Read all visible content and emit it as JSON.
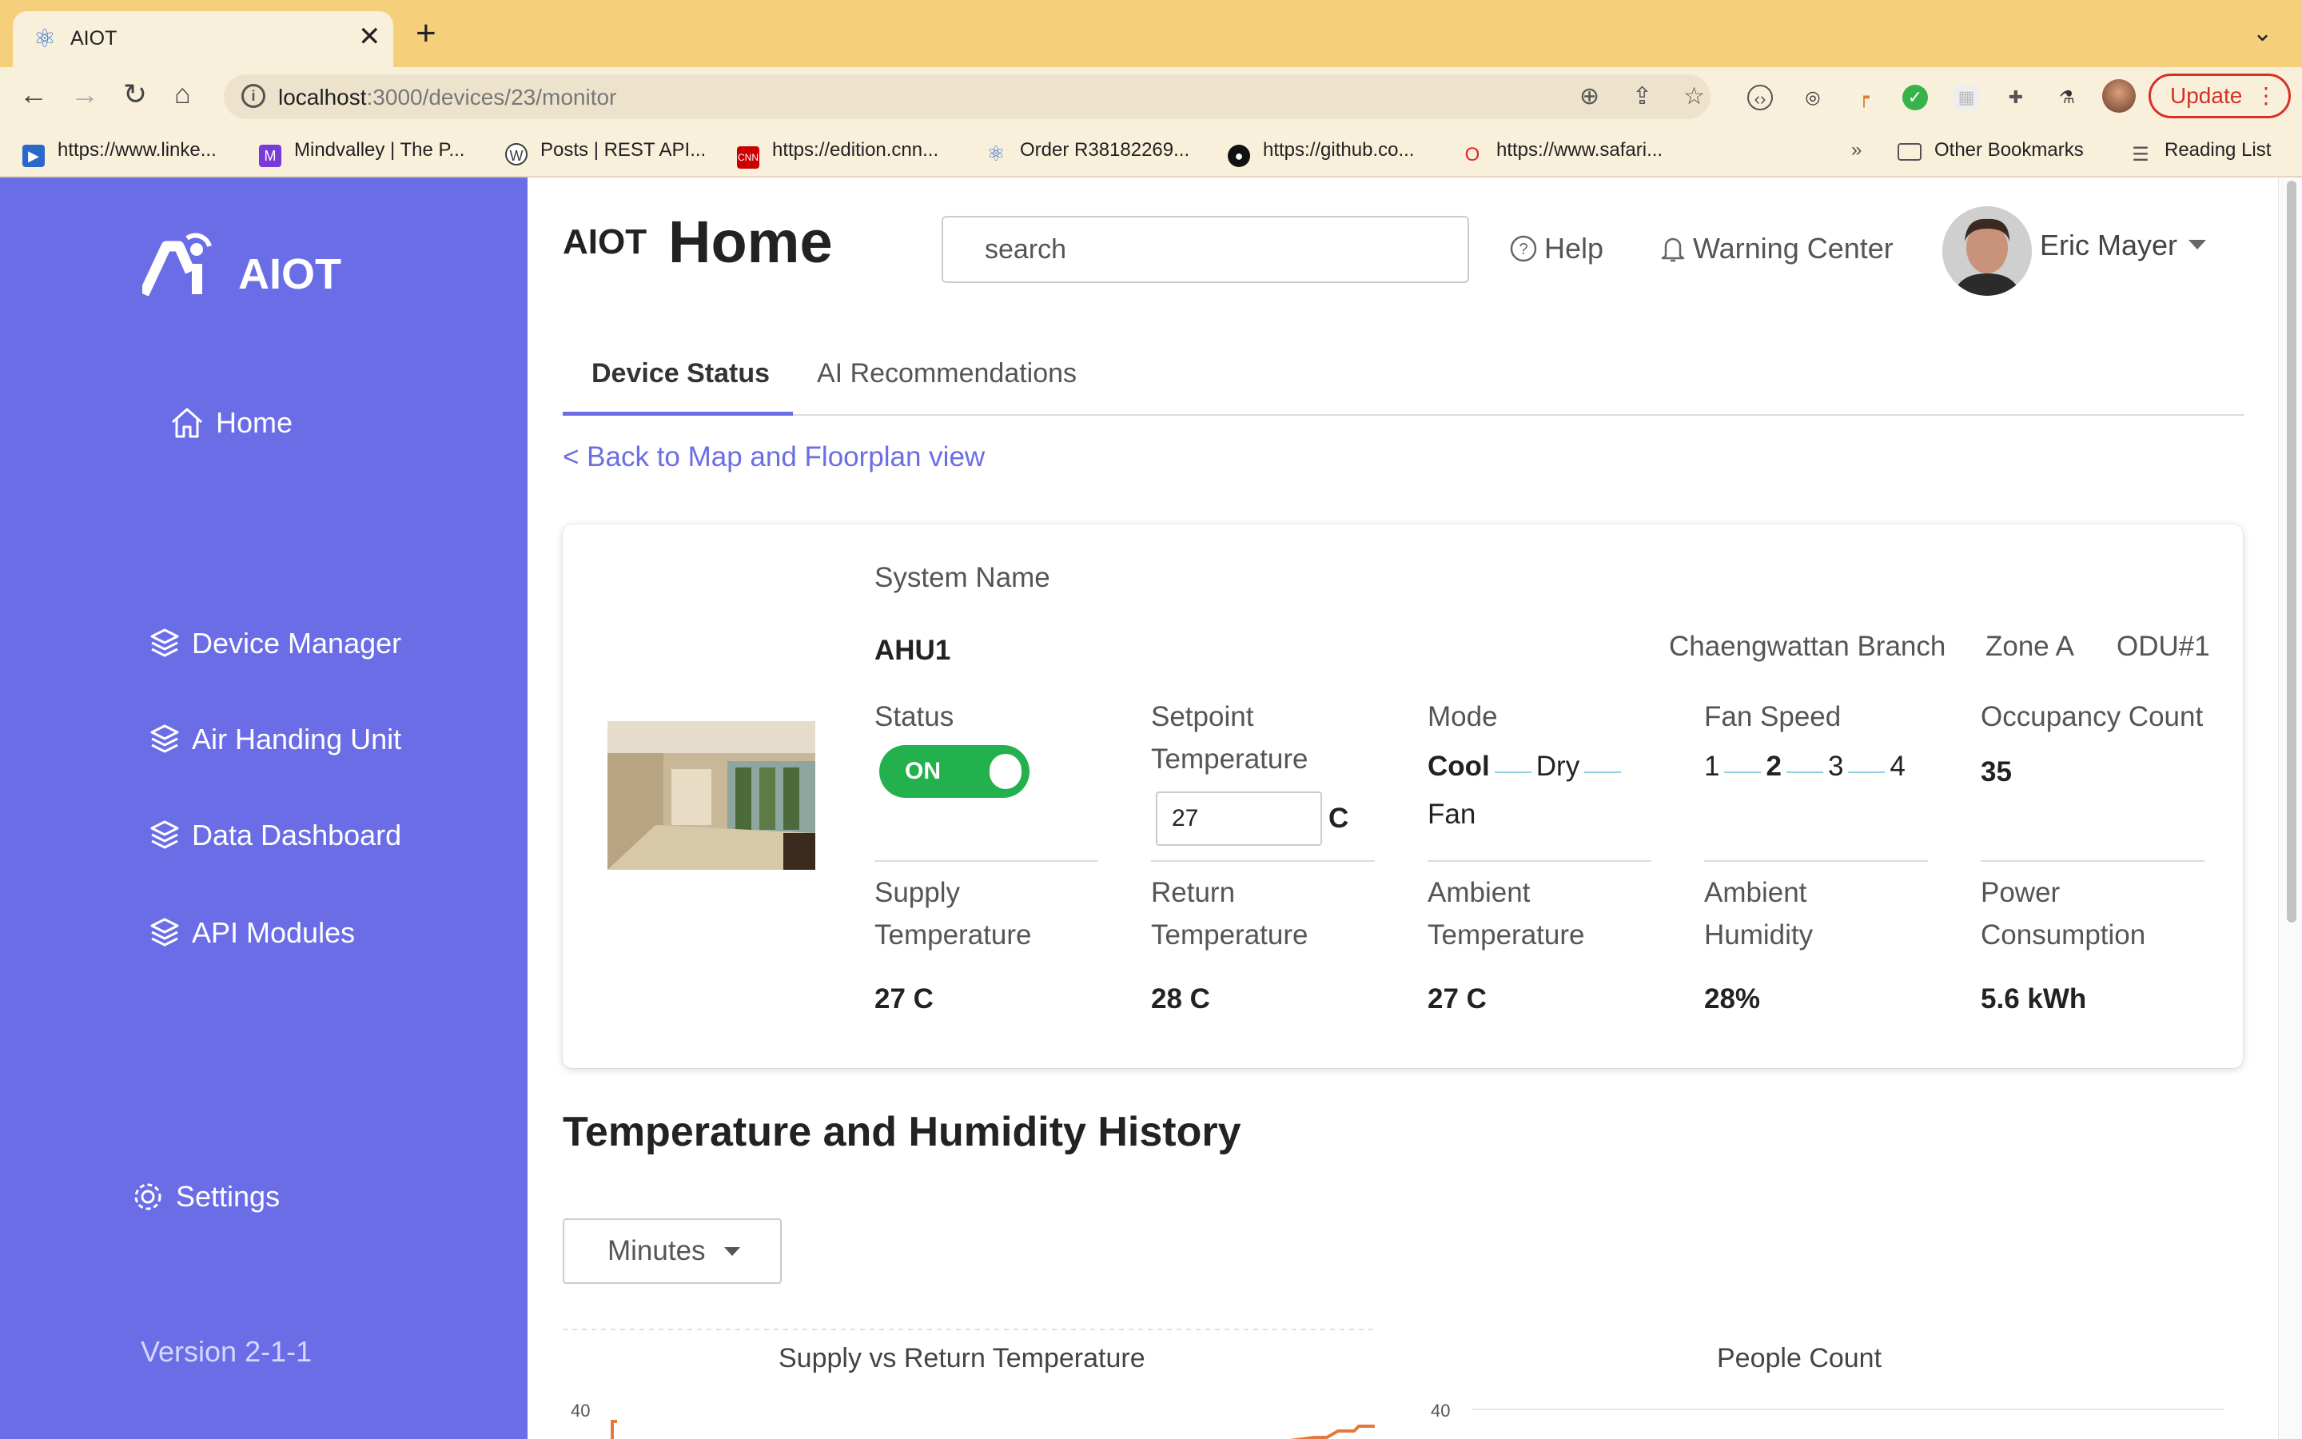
{
  "browser": {
    "tab_title": "AIOT",
    "url_host": "localhost",
    "url_path": ":3000/devices/23/monitor",
    "update_label": "Update",
    "bookmarks": [
      {
        "label": "https://www.linke...",
        "icon": "video-icon",
        "color": "#2a68c9"
      },
      {
        "label": "Mindvalley | The P...",
        "icon": "mindvalley-icon",
        "color": "#7a3ad9"
      },
      {
        "label": "Posts | REST API...",
        "icon": "wordpress-icon",
        "color": "#3d3d3d"
      },
      {
        "label": "https://edition.cnn...",
        "icon": "cnn-icon",
        "color": "#cc0000"
      },
      {
        "label": "Order R38182269...",
        "icon": "react-icon",
        "color": "#3a7bd5"
      },
      {
        "label": "https://github.co...",
        "icon": "github-icon",
        "color": "#111111"
      },
      {
        "label": "https://www.safari...",
        "icon": "safari-icon",
        "color": "#e02424"
      }
    ],
    "other_bookmarks": "Other Bookmarks",
    "reading_list": "Reading List",
    "overflow": "»"
  },
  "sidebar": {
    "logo": "AIOT",
    "items": [
      {
        "label": "Home",
        "icon": "home-icon"
      },
      {
        "label": "Device Manager",
        "icon": "layers-icon"
      },
      {
        "label": "Air Handing Unit",
        "icon": "layers-icon"
      },
      {
        "label": "Data Dashboard",
        "icon": "layers-icon"
      },
      {
        "label": "API Modules",
        "icon": "layers-icon"
      }
    ],
    "settings": "Settings",
    "version": "Version 2-1-1",
    "accent": "#6b6de6"
  },
  "header": {
    "brand": "AIOT",
    "title": "Home",
    "search_placeholder": "search",
    "help": "Help",
    "warning": "Warning Center",
    "user": "Eric Mayer"
  },
  "tabs": [
    "Device Status",
    "AI Recommendations"
  ],
  "back_link": "< Back to Map and Floorplan view",
  "device": {
    "system_name_label": "System Name",
    "system_name": "AHU1",
    "branch": "Chaengwattan Branch",
    "zone": "Zone A",
    "odu": "ODU#1",
    "status_label": "Status",
    "status_value": "ON",
    "status_color": "#22b14c",
    "setpoint_label": "Setpoint Temperature",
    "setpoint_value": "27",
    "setpoint_unit": "C",
    "mode_label": "Mode",
    "modes": [
      "Cool",
      "Dry",
      "Fan"
    ],
    "mode_selected": "Cool",
    "fan_label": "Fan Speed",
    "fan_speeds": [
      "1",
      "2",
      "3",
      "4"
    ],
    "fan_selected": "2",
    "occupancy_label": "Occupancy Count",
    "occupancy_value": "35",
    "supply_label": "Supply Temperature",
    "supply_value": "27 C",
    "return_label": "Return Temperature",
    "return_value": "28 C",
    "ambient_temp_label": "Ambient Temperature",
    "ambient_temp_value": "27 C",
    "ambient_hum_label": "Ambient Humidity",
    "ambient_hum_value": "28%",
    "power_label": "Power Consumption",
    "power_value": "5.6 kWh"
  },
  "history": {
    "title": "Temperature and Humidity History",
    "range_label": "Minutes",
    "charts": [
      {
        "title": "Supply vs Return Temperature",
        "y_top_tick": "40"
      },
      {
        "title": "People Count",
        "y_top_tick": "40"
      }
    ]
  }
}
